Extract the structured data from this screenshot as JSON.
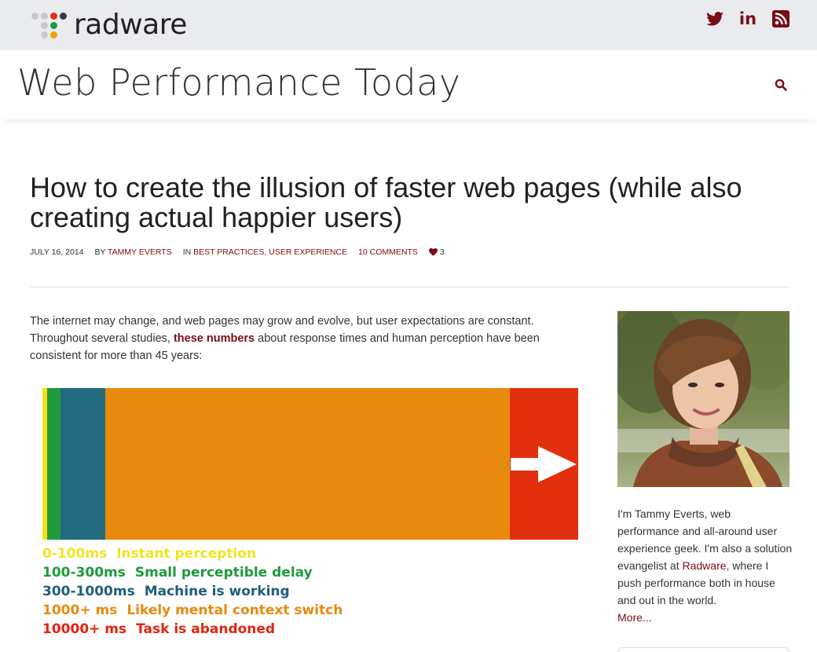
{
  "topbar": {
    "logo_text": "radware",
    "social": [
      {
        "icon": "twitter-icon"
      },
      {
        "icon": "linkedin-icon",
        "label": "in"
      },
      {
        "icon": "rss-icon"
      }
    ]
  },
  "site": {
    "title": "Web Performance Today",
    "search_icon": "search-icon"
  },
  "post": {
    "title": "How to create the illusion of faster web pages (while also creating actual happier users)",
    "date": "JULY 16, 2014",
    "by_prefix": "BY ",
    "author": "TAMMY EVERTS",
    "in_prefix": "IN ",
    "categories": "BEST PRACTICES, USER EXPERIENCE",
    "comments": "10 COMMENTS",
    "likes": "3",
    "intro_before": "The internet may change, and web pages may grow and evolve, but user expectations are constant. Throughout several studies, ",
    "intro_link": "these numbers",
    "intro_after": " about response times and human perception have been consistent for more than 45 years:"
  },
  "figure": {
    "colors": {
      "instant": "#f4e11b",
      "small_delay": "#1f9a3a",
      "machine": "#236a80",
      "context": "#e88a0e",
      "abandoned": "#e2300f"
    },
    "labels": [
      {
        "range": "0-100ms",
        "desc": "Instant perception",
        "color": "#f2e41f"
      },
      {
        "range": "100-300ms",
        "desc": "Small perceptible delay",
        "color": "#1f9a3a"
      },
      {
        "range": "300-1000ms",
        "desc": "Machine is working",
        "color": "#1f5f7a"
      },
      {
        "range": "1000+ ms",
        "desc": "Likely mental context switch",
        "color": "#e88a0e"
      },
      {
        "range": "10000+ ms",
        "desc": "Task is abandoned",
        "color": "#e2240f"
      }
    ]
  },
  "sidebar": {
    "bio_before": "I'm Tammy Everts, web performance and all-around user experience geek. I'm also a solution evangelist at ",
    "bio_link": "Radware",
    "bio_after": ", where I push performance both in house and out in the world.",
    "more": "More..."
  }
}
